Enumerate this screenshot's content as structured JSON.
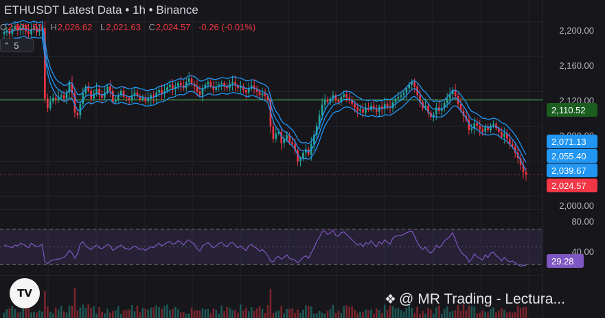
{
  "header": {
    "title": "ETHUSDT Latest Data • 1h • Binance",
    "ohlc": [
      {
        "key": "O",
        "value": "2,024.83"
      },
      {
        "key": "H",
        "value": "2,026.62"
      },
      {
        "key": "L",
        "value": "2,021.63"
      },
      {
        "key": "C",
        "value": "2,024.57"
      }
    ],
    "change": "-0.26 (-0.01%)",
    "indicator_count": "5",
    "indicator_chevron": "chevron-up-icon"
  },
  "price_axis": {
    "labels": [
      "2,200.00",
      "2,160.00",
      "2,120.00",
      "2,080.00",
      "2,000.00"
    ]
  },
  "price_tags": {
    "green_line": "2,110.52",
    "band_upper": "2,071.13",
    "band_mid": "2,055.40",
    "band_lower": "2,039.67",
    "last_price": "2,024.57"
  },
  "rsi_axis": {
    "labels": [
      "80.00",
      "40.00"
    ],
    "value": "29.28",
    "upper": 70,
    "lower": 30
  },
  "watermark": "@ MR Trading - Lectura...",
  "colors": {
    "up": "#26a69a",
    "down": "#f23645",
    "band": "#2196f3",
    "rsi": "#7e57c2",
    "hline": "#4caf50",
    "background": "#17171b"
  },
  "chart_data": {
    "type": "candlestick",
    "symbol": "ETHUSDT",
    "interval": "1h",
    "exchange": "Binance",
    "ylim": [
      1985,
      2225
    ],
    "close_series": [
      2188,
      2190,
      2186,
      2192,
      2195,
      2190,
      2193,
      2196,
      2189,
      2186,
      2192,
      2194,
      2188,
      2190,
      2193,
      2112,
      2101,
      2109,
      2113,
      2111,
      2114,
      2116,
      2112,
      2119,
      2130,
      2118,
      2096,
      2093,
      2106,
      2118,
      2126,
      2121,
      2112,
      2118,
      2123,
      2116,
      2113,
      2119,
      2126,
      2121,
      2108,
      2111,
      2116,
      2121,
      2114,
      2113,
      2111,
      2116,
      2119,
      2115,
      2111,
      2113,
      2109,
      2112,
      2116,
      2114,
      2119,
      2122,
      2118,
      2121,
      2125,
      2128,
      2123,
      2126,
      2130,
      2127,
      2124,
      2131,
      2135,
      2129,
      2126,
      2120,
      2116,
      2124,
      2128,
      2131,
      2126,
      2122,
      2125,
      2128,
      2130,
      2126,
      2124,
      2129,
      2131,
      2127,
      2124,
      2126,
      2122,
      2119,
      2124,
      2127,
      2123,
      2120,
      2116,
      2118,
      2115,
      2110,
      2080,
      2066,
      2072,
      2074,
      2061,
      2065,
      2070,
      2062,
      2060,
      2053,
      2040,
      2044,
      2050,
      2054,
      2048,
      2060,
      2070,
      2081,
      2093,
      2105,
      2111,
      2108,
      2112,
      2116,
      2110,
      2108,
      2114,
      2117,
      2113,
      2110,
      2106,
      2102,
      2098,
      2100,
      2096,
      2101,
      2099,
      2104,
      2100,
      2097,
      2103,
      2100,
      2106,
      2103,
      2101,
      2108,
      2112,
      2114,
      2116,
      2119,
      2124,
      2128,
      2131,
      2126,
      2116,
      2108,
      2101,
      2104,
      2096,
      2091,
      2094,
      2102,
      2098,
      2101,
      2107,
      2112,
      2117,
      2122,
      2115,
      2106,
      2098,
      2092,
      2088,
      2076,
      2078,
      2084,
      2081,
      2077,
      2074,
      2080,
      2076,
      2081,
      2083,
      2078,
      2074,
      2068,
      2072,
      2066,
      2060,
      2057,
      2050,
      2044,
      2036,
      2028,
      2025
    ],
    "indicators": {
      "bands": {
        "upper": 2071.13,
        "middle": 2055.4,
        "lower": 2039.67
      },
      "horizontal_line": 2110.52,
      "rsi": {
        "value": 29.28,
        "levels": [
          70,
          30
        ],
        "ylim": [
          20,
          90
        ]
      }
    },
    "rsi_series": [
      52,
      51,
      50,
      49,
      52,
      51,
      54,
      53,
      51,
      49,
      54,
      52,
      50,
      51,
      53,
      33,
      31,
      34,
      35,
      36,
      36,
      37,
      38,
      41,
      46,
      43,
      37,
      42,
      53,
      56,
      51,
      49,
      47,
      50,
      52,
      49,
      48,
      50,
      53,
      51,
      46,
      48,
      50,
      52,
      49,
      48,
      47,
      49,
      51,
      49,
      47,
      48,
      46,
      48,
      50,
      49,
      52,
      54,
      51,
      53,
      55,
      56,
      53,
      54,
      57,
      55,
      52,
      56,
      58,
      55,
      53,
      48,
      45,
      51,
      53,
      55,
      52,
      49,
      51,
      54,
      55,
      52,
      50,
      54,
      55,
      52,
      49,
      51,
      48,
      46,
      51,
      53,
      50,
      48,
      45,
      47,
      44,
      40,
      34,
      33,
      38,
      39,
      36,
      38,
      41,
      37,
      36,
      35,
      32,
      35,
      38,
      40,
      37,
      43,
      49,
      56,
      61,
      67,
      68,
      64,
      66,
      69,
      63,
      62,
      66,
      67,
      64,
      61,
      58,
      55,
      52,
      54,
      50,
      55,
      53,
      57,
      53,
      50,
      56,
      53,
      58,
      55,
      53,
      60,
      62,
      63,
      63,
      64,
      66,
      67,
      68,
      62,
      55,
      50,
      47,
      50,
      45,
      43,
      46,
      52,
      49,
      52,
      57,
      59,
      62,
      66,
      58,
      50,
      45,
      41,
      39,
      33,
      36,
      42,
      39,
      37,
      35,
      41,
      38,
      43,
      44,
      40,
      38,
      34,
      38,
      35,
      33,
      34,
      32,
      30,
      28,
      29,
      29
    ]
  }
}
